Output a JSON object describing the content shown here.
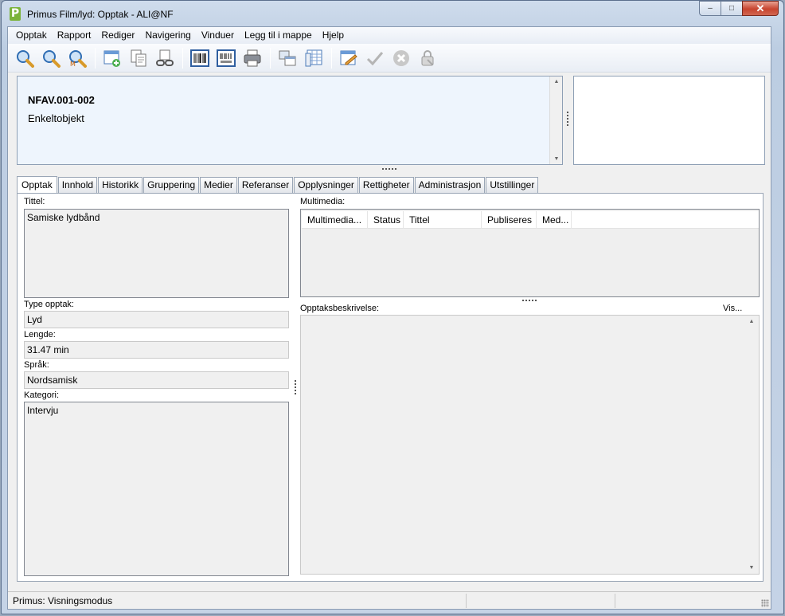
{
  "window": {
    "title": "Primus Film/lyd: Opptak - ALI@NF",
    "app_icon_letter": "P",
    "minimize": "–",
    "maximize": "□",
    "close": "✕"
  },
  "menu": [
    "Opptak",
    "Rapport",
    "Rediger",
    "Navigering",
    "Vinduer",
    "Legg til i mappe",
    "Hjelp"
  ],
  "toolbar": {
    "icons": [
      "search-icon",
      "search-icon-2",
      "search-m-icon",
      "new-record-icon",
      "copy-icon",
      "link-icon",
      "barcode-icon",
      "barcode-label-icon",
      "print-icon",
      "compare-icon",
      "table-icon",
      "edit-icon",
      "check-icon",
      "cancel-icon",
      "lock-icon"
    ]
  },
  "header": {
    "identifier": "NFAV.001-002",
    "subtitle": "Enkeltobjekt"
  },
  "tabs": [
    "Opptak",
    "Innhold",
    "Historikk",
    "Gruppering",
    "Medier",
    "Referanser",
    "Opplysninger",
    "Rettigheter",
    "Administrasjon",
    "Utstillinger"
  ],
  "active_tab": "Opptak",
  "form": {
    "tittel_label": "Tittel:",
    "tittel_value": "Samiske lydbånd",
    "type_label": "Type opptak:",
    "type_value": "Lyd",
    "lengde_label": "Lengde:",
    "lengde_value": "31.47 min",
    "sprak_label": "Språk:",
    "sprak_value": "Nordsamisk",
    "kategori_label": "Kategori:",
    "kategori_value": "Intervju"
  },
  "multimedia": {
    "label": "Multimedia:",
    "columns": [
      "Multimedia...",
      "Status",
      "Tittel",
      "Publiseres",
      "Med..."
    ]
  },
  "description": {
    "label": "Opptaksbeskrivelse:",
    "link": "Vis..."
  },
  "status": {
    "text": "Primus: Visningsmodus"
  },
  "colors": {
    "header_bg": "#eef5fd",
    "window_frame": "#bccde2",
    "close_button": "#c7442f"
  }
}
